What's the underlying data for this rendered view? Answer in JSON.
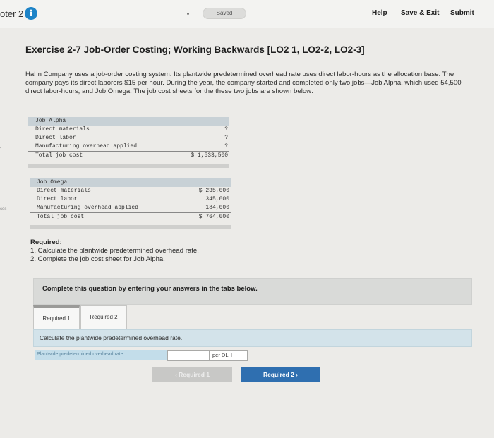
{
  "topbar": {
    "chapter": "oter 2",
    "status_pill": "Saved",
    "help": "Help",
    "save_exit": "Save & Exit",
    "submit": "Submit",
    "info_glyph": "i",
    "icons": [
      "info-icon"
    ]
  },
  "left_edge_fragments": [
    "‹",
    "ces"
  ],
  "exercise": {
    "title": "Exercise 2-7 Job-Order Costing; Working Backwards [LO2 1, LO2-2, LO2-3]",
    "intro": "Hahn Company uses a job-order costing system. Its plantwide predetermined overhead rate uses direct labor-hours as the allocation base. The company pays its direct laborers $15 per hour. During the year, the company started and completed only two jobs—Job Alpha, which used 54,500 direct labor-hours, and Job Omega. The job cost sheets for the these two jobs are shown below:"
  },
  "job_alpha": {
    "rows": [
      {
        "label": "Job Alpha",
        "value": ""
      },
      {
        "label": "Direct materials",
        "value": "?"
      },
      {
        "label": "Direct labor",
        "value": "?"
      },
      {
        "label": "Manufacturing overhead applied",
        "value": "?"
      },
      {
        "label": "Total job cost",
        "value": "$ 1,533,500"
      }
    ]
  },
  "job_omega": {
    "rows": [
      {
        "label": "Job Omega",
        "value": ""
      },
      {
        "label": "Direct materials",
        "value": "$ 235,000"
      },
      {
        "label": "Direct labor",
        "value": "345,000"
      },
      {
        "label": "Manufacturing overhead applied",
        "value": "184,000"
      },
      {
        "label": "Total job cost",
        "value": "$ 764,000"
      }
    ]
  },
  "required": {
    "heading": "Required:",
    "items": [
      "1. Calculate the plantwide predetermined overhead rate.",
      "2. Complete the job cost sheet for Job Alpha."
    ]
  },
  "question": {
    "banner": "Complete this question by entering your answers in the tabs below.",
    "tabs": [
      "Required 1",
      "Required 2"
    ],
    "instruction": "Calculate the plantwide predetermined overhead rate.",
    "answer_label": "Plantwide predetermined overhead rate",
    "answer_value": "",
    "unit": "per DLH",
    "prev_button": "‹ Required 1",
    "next_button": "Required 2 ›"
  },
  "colors": {
    "accent": "#2f6fb0",
    "info": "#1d83c7",
    "tab_band": "#d3e3ea"
  }
}
